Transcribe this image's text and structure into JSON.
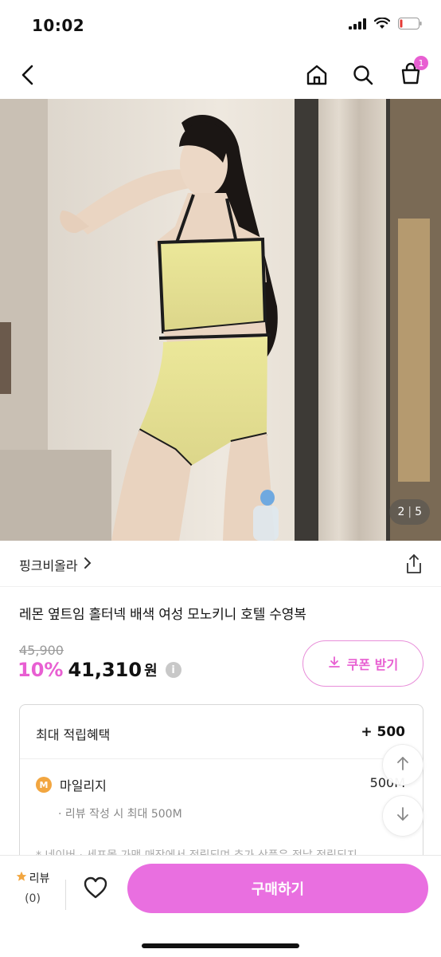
{
  "status_bar": {
    "time": "10:02",
    "icons": [
      "signal-icon",
      "wifi-icon",
      "battery-icon"
    ]
  },
  "header": {
    "icons": [
      "back-icon",
      "home-icon",
      "search-icon",
      "cart-icon"
    ],
    "cart_count": "1"
  },
  "gallery": {
    "current": "2",
    "total": "5"
  },
  "shop": {
    "name": "핑크비올라"
  },
  "product": {
    "title": "레몬 옆트임 홀터넥 배색 여성 모노키니 호텔 수영복",
    "original_price": "45,900",
    "discount": "10%",
    "price": "41,310",
    "currency": "원",
    "coupon_label": "쿠폰 받기"
  },
  "benefit": {
    "label": "최대 적립혜택",
    "value": "+ 500",
    "mileage_label": "마일리지",
    "mileage_value": "500M",
    "mileage_note": "리뷰 작성 시 최대 500M",
    "faded_text": "* 네이버 · 세포몰 가맹 매장에서 적립되며 추가 상품은 적날 적립되지"
  },
  "bottom_bar": {
    "review_label": "리뷰",
    "review_count": "(0)",
    "buy_label": "구매하기"
  },
  "colors": {
    "accent": "#e85fd2",
    "buy_button": "#e96fe0",
    "coin": "#f2a640"
  }
}
